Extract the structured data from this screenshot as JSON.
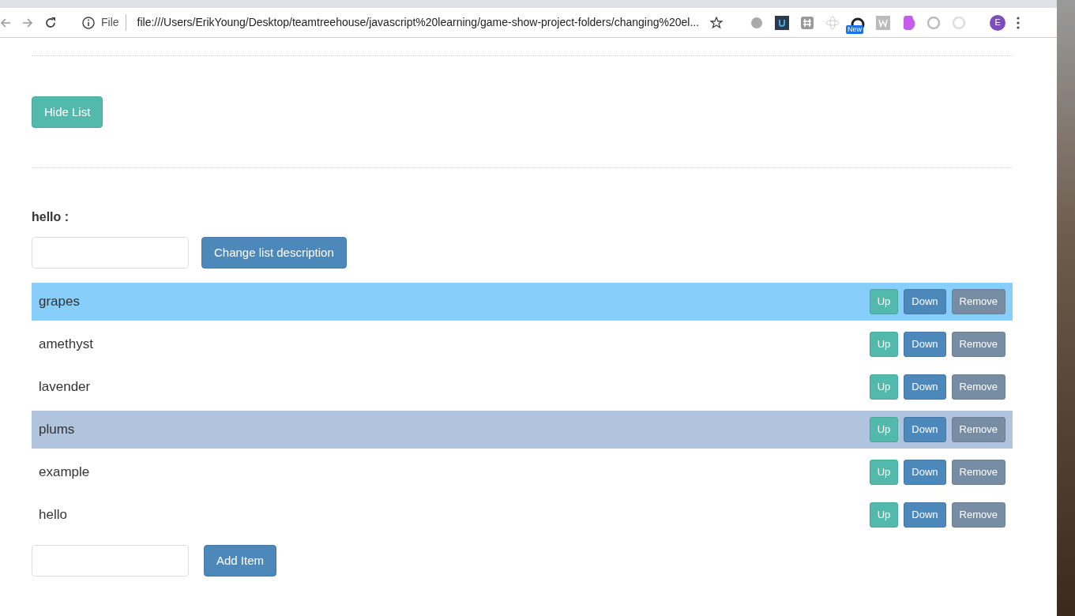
{
  "browser": {
    "scheme_label": "File",
    "url": "file:///Users/ErikYoung/Desktop/teamtreehouse/javascript%20learning/game-show-project-folders/changing%20el...",
    "extension_badge": "New",
    "profile_initial": "E"
  },
  "toggle_button": "Hide List",
  "description": {
    "title": "hello :",
    "button": "Change list description"
  },
  "items": [
    {
      "text": "grapes",
      "color": "#87cefa",
      "buttons": [
        "Up",
        "Down",
        "Remove"
      ]
    },
    {
      "text": "amethyst",
      "color": "#ffffff",
      "buttons": [
        "Up",
        "Down",
        "Remove"
      ]
    },
    {
      "text": "lavender",
      "color": "#ffffff",
      "buttons": [
        "Up",
        "Down",
        "Remove"
      ]
    },
    {
      "text": "plums",
      "color": "#b0c4de",
      "buttons": [
        "Up",
        "Down",
        "Remove"
      ]
    },
    {
      "text": "example",
      "color": "#ffffff",
      "buttons": [
        "Up",
        "Down",
        "Remove"
      ]
    },
    {
      "text": "hello",
      "color": "#ffffff",
      "buttons": [
        "Up",
        "Down",
        "Remove"
      ]
    }
  ],
  "add_button": "Add Item"
}
